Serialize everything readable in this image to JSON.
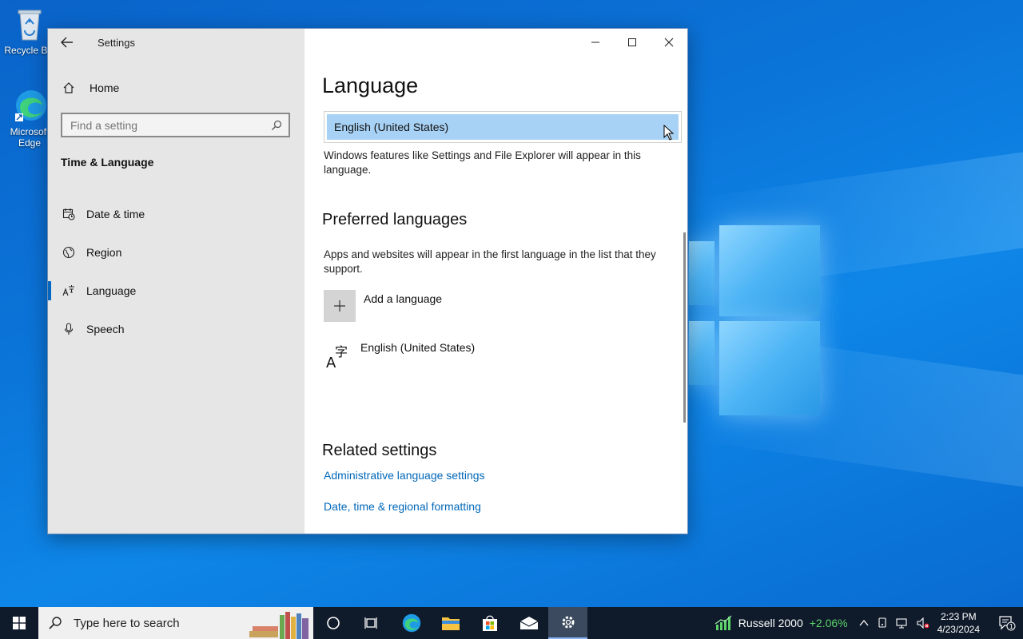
{
  "desktop": {
    "icons": [
      {
        "label": "Recycle Bin"
      },
      {
        "label": "Microsoft Edge"
      }
    ]
  },
  "window": {
    "title": "Settings",
    "sidebar": {
      "home_label": "Home",
      "search_placeholder": "Find a setting",
      "section_label": "Time & Language",
      "items": [
        {
          "label": "Date & time",
          "icon": "calendar-clock-icon",
          "selected": false
        },
        {
          "label": "Region",
          "icon": "globe-icon",
          "selected": false
        },
        {
          "label": "Language",
          "icon": "language-icon",
          "selected": true
        },
        {
          "label": "Speech",
          "icon": "microphone-icon",
          "selected": false
        }
      ]
    },
    "content": {
      "page_title": "Language",
      "display_language_value": "English (United States)",
      "display_language_desc": "Windows features like Settings and File Explorer will appear in this language.",
      "preferred_heading": "Preferred languages",
      "preferred_desc": "Apps and websites will appear in the first language in the list that they support.",
      "add_language_label": "Add a language",
      "installed_languages": [
        "English (United States)"
      ],
      "related_heading": "Related settings",
      "related_links": [
        "Administrative language settings",
        "Date, time & regional formatting"
      ]
    }
  },
  "taskbar": {
    "search_placeholder": "Type here to search",
    "stock_name": "Russell 2000",
    "stock_change": "+2.06%",
    "time": "2:23 PM",
    "date": "4/23/2024",
    "notification_count": "1"
  },
  "colors": {
    "accent": "#0067c0",
    "link": "#0067b8",
    "selection": "#a8d2f5",
    "stock_up": "#5bd36a"
  }
}
